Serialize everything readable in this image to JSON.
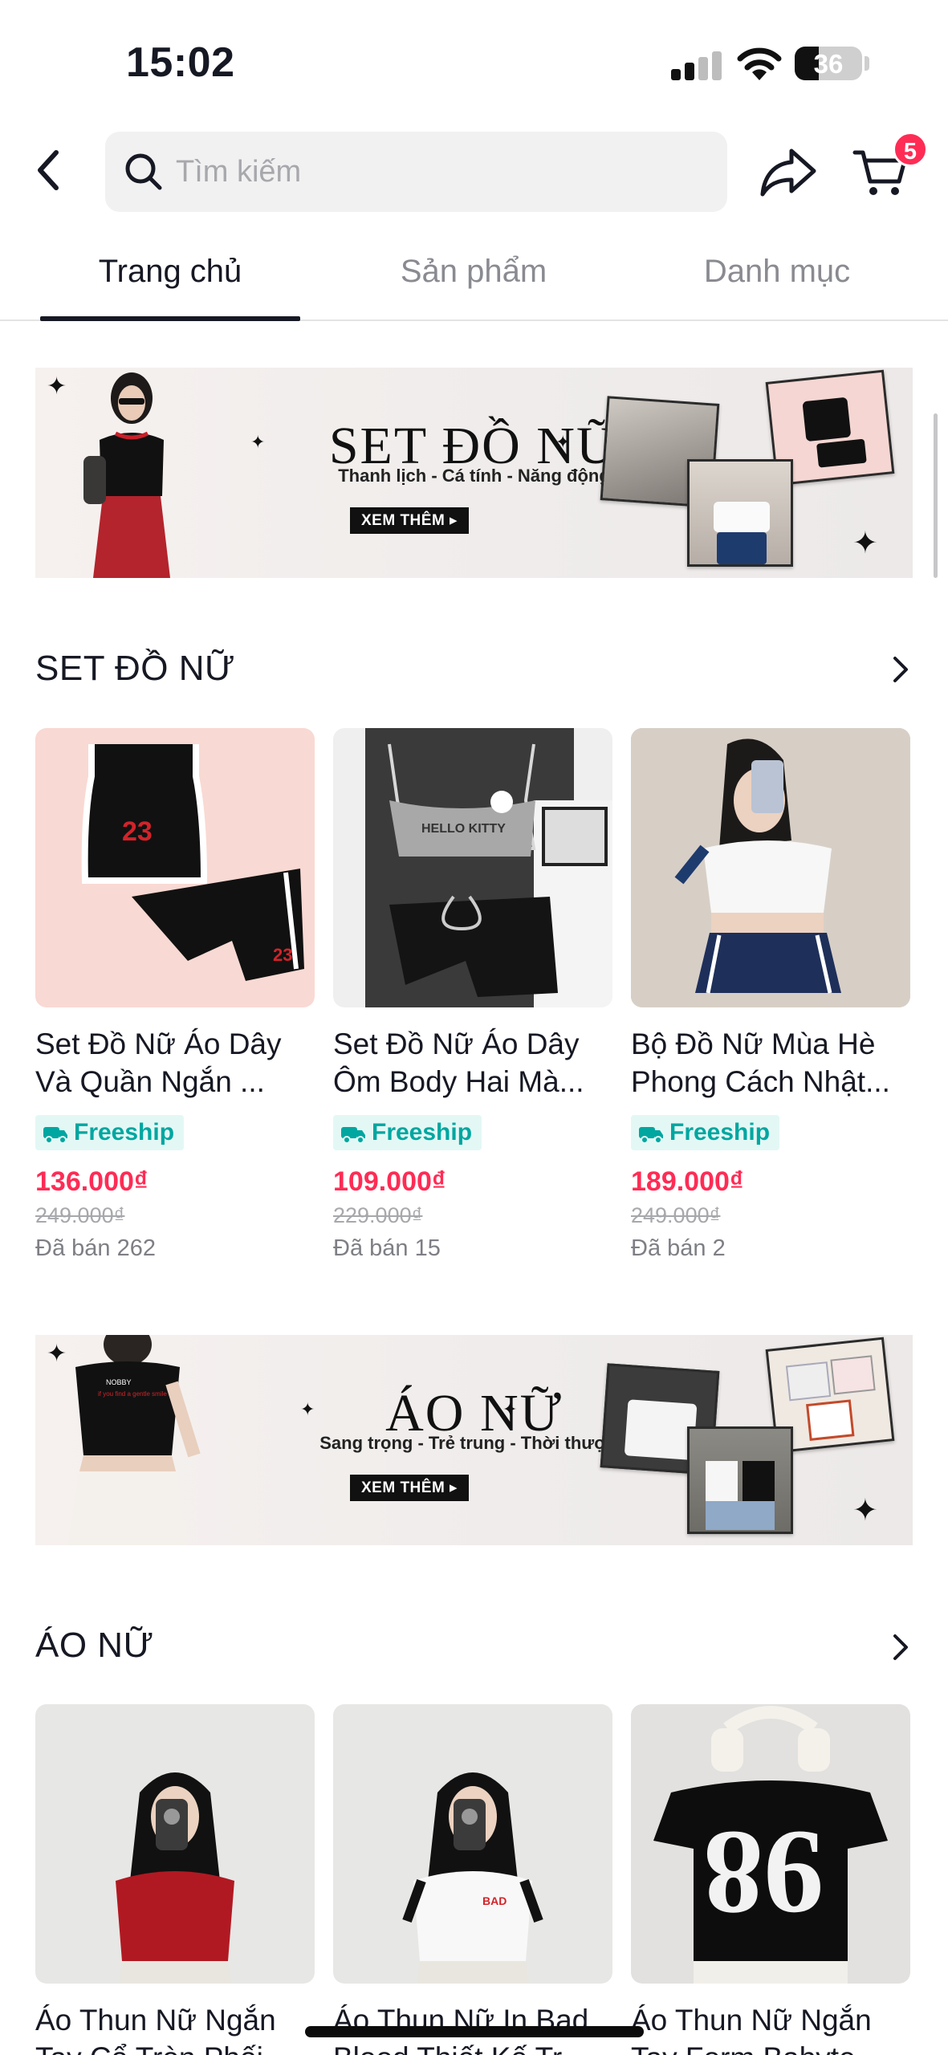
{
  "status_bar": {
    "time": "15:02",
    "battery": "36",
    "battery_level": 0.36,
    "signal_bars_active": 2
  },
  "header": {
    "search_placeholder": "Tìm kiếm",
    "cart_count": "5",
    "icons": [
      "back-icon",
      "search-icon",
      "share-icon",
      "cart-icon"
    ]
  },
  "tabs": [
    {
      "label": "Trang chủ",
      "active": true
    },
    {
      "label": "Sản phẩm",
      "active": false
    },
    {
      "label": "Danh mục",
      "active": false
    }
  ],
  "banner1": {
    "title": "SET ĐỒ NỮ",
    "subtitle": "Thanh lịch - Cá tính - Năng động",
    "button": "XEM THÊM ▸"
  },
  "section1": {
    "title": "SET ĐỒ NỮ",
    "products": [
      {
        "name_line1": "Set Đồ Nữ Áo Dây",
        "name_line2": "Và Quần Ngắn ...",
        "badge": "Freeship",
        "price": "136.000₫",
        "old_price": "249.000₫",
        "sold": "Đã bán 262"
      },
      {
        "name_line1": "Set Đồ Nữ Áo Dây",
        "name_line2": "Ôm Body Hai Mà...",
        "badge": "Freeship",
        "price": "109.000₫",
        "old_price": "229.000₫",
        "sold": "Đã bán 15"
      },
      {
        "name_line1": "Bộ Đồ Nữ Mùa Hè",
        "name_line2": "Phong Cách Nhật...",
        "badge": "Freeship",
        "price": "189.000₫",
        "old_price": "249.000₫",
        "sold": "Đã bán 2"
      }
    ]
  },
  "banner2": {
    "title": "ÁO NỮ",
    "subtitle": "Sang trọng - Trẻ trung - Thời thượng",
    "button": "XEM THÊM ▸"
  },
  "section2": {
    "title": "ÁO NỮ",
    "products": [
      {
        "name_line1": "Áo Thun Nữ Ngắn",
        "name_line2": "Tay Cổ Tròn Phối..."
      },
      {
        "name_line1": "Áo Thun Nữ In Bad",
        "name_line2": "Blood Thiết Kế Tr..."
      },
      {
        "name_line1": "Áo Thun Nữ Ngắn",
        "name_line2": "Tay Form Babyte..."
      }
    ]
  },
  "colors": {
    "accent": "#fe2c55",
    "freeship_text": "#00a6a0",
    "freeship_bg": "#e3f8f5",
    "text": "#161823",
    "muted": "#8a8b91"
  }
}
